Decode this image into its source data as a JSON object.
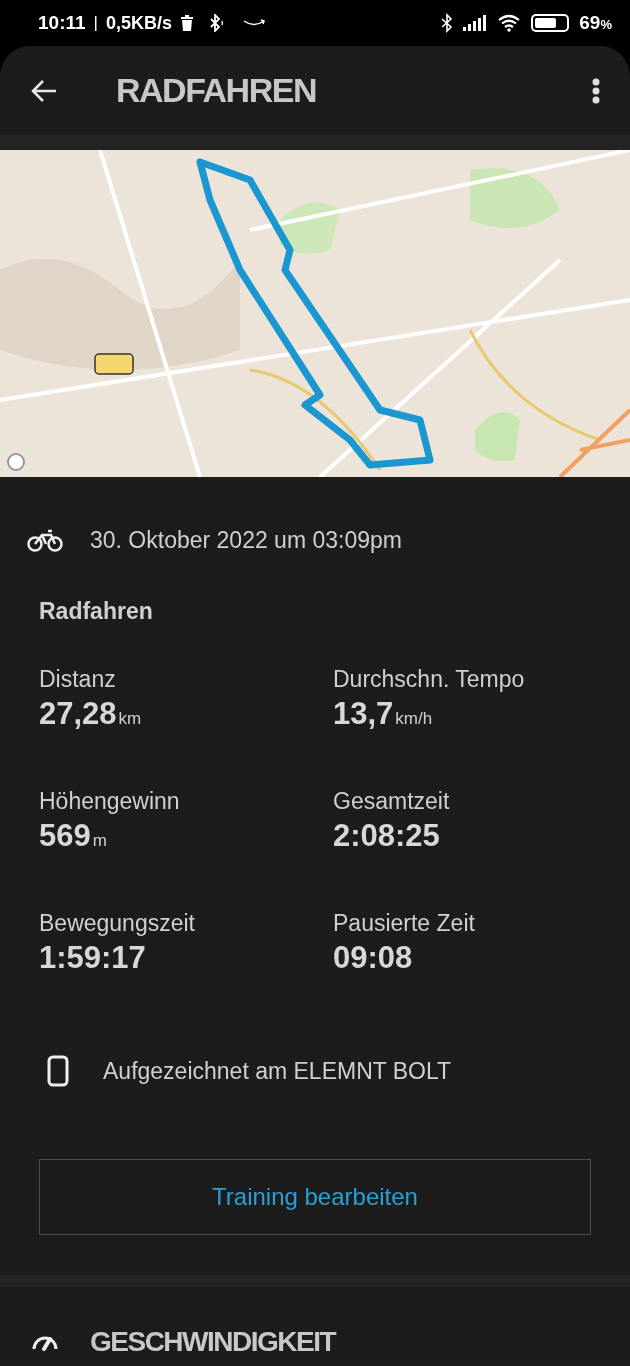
{
  "status_bar": {
    "time": "10:11",
    "separator": "|",
    "speed": "0,5KB/s",
    "battery": "69",
    "battery_unit": "%"
  },
  "header": {
    "title": "RADFAHREN"
  },
  "activity": {
    "date": "30. Oktober 2022 um 03:09pm",
    "name": "Radfahren"
  },
  "stats": [
    {
      "label": "Distanz",
      "value": "27,28",
      "unit": "km"
    },
    {
      "label": "Durchschn. Tempo",
      "value": "13,7",
      "unit": "km/h"
    },
    {
      "label": "Höhengewinn",
      "value": "569",
      "unit": "m"
    },
    {
      "label": "Gesamtzeit",
      "value": "2:08:25"
    },
    {
      "label": "Bewegungszeit",
      "value": "1:59:17"
    },
    {
      "label": "Pausierte Zeit",
      "value": "09:08"
    }
  ],
  "device": {
    "text": "Aufgezeichnet am ELEMNT BOLT"
  },
  "edit_button": {
    "label": "Training bearbeiten"
  },
  "section": {
    "title": "GESCHWINDIGKEIT"
  }
}
